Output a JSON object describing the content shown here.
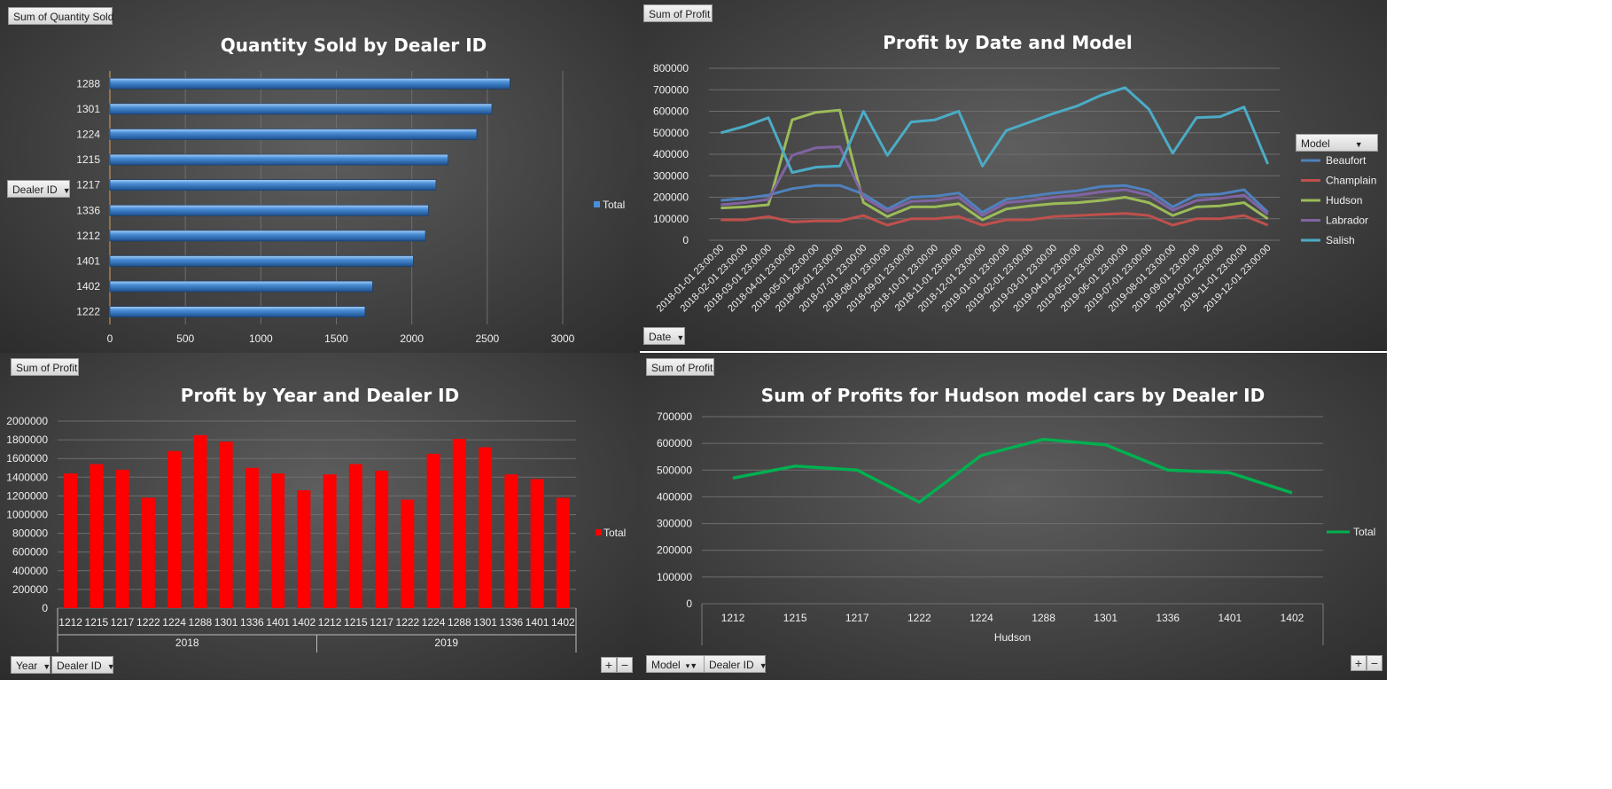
{
  "charts": {
    "c1": {
      "field_button": "Sum of Quantity Sold",
      "axis_button": "Dealer ID",
      "legend": "Total"
    },
    "c2": {
      "field_button": "Sum of Profit",
      "axis_button": "Date",
      "legend_button": "Model"
    },
    "c3": {
      "field_button": "Sum of Profit",
      "axis_buttons": [
        "Year",
        "Dealer ID"
      ],
      "legend": "Total"
    },
    "c4": {
      "field_button": "Sum of Profit",
      "axis_buttons": [
        "Model",
        "Dealer ID"
      ],
      "legend": "Total"
    }
  },
  "colors": {
    "bar_blue": "#4a8fd8",
    "line_beaufort": "#4f81bd",
    "line_champlain": "#c0504d",
    "line_hudson": "#9bbb59",
    "line_labrador": "#8064a2",
    "line_salish": "#4bacc6",
    "bar_red": "#ff0000",
    "line_green": "#00b050"
  },
  "chart_data": [
    {
      "id": "c1",
      "type": "bar",
      "orientation": "horizontal",
      "title": "Quantity Sold by Dealer ID",
      "categories": [
        "1288",
        "1301",
        "1224",
        "1215",
        "1217",
        "1336",
        "1212",
        "1401",
        "1402",
        "1222"
      ],
      "series": [
        {
          "name": "Total",
          "values": [
            2650,
            2530,
            2430,
            2240,
            2160,
            2110,
            2090,
            2010,
            1740,
            1690
          ]
        }
      ],
      "xlim": [
        0,
        3000
      ],
      "xticks": [
        0,
        500,
        1000,
        1500,
        2000,
        2500,
        3000
      ],
      "grid": true,
      "legend": "right"
    },
    {
      "id": "c2",
      "type": "line",
      "title": "Profit by Date and Model",
      "categories": [
        "2018-01-01 23:00:00",
        "2018-02-01 23:00:00",
        "2018-03-01 23:00:00",
        "2018-04-01 23:00:00",
        "2018-05-01 23:00:00",
        "2018-06-01 23:00:00",
        "2018-07-01 23:00:00",
        "2018-08-01 23:00:00",
        "2018-09-01 23:00:00",
        "2018-10-01 23:00:00",
        "2018-11-01 23:00:00",
        "2018-12-01 23:00:00",
        "2019-01-01 23:00:00",
        "2019-02-01 23:00:00",
        "2019-03-01 23:00:00",
        "2019-04-01 23:00:00",
        "2019-05-01 23:00:00",
        "2019-06-01 23:00:00",
        "2019-07-01 23:00:00",
        "2019-08-01 23:00:00",
        "2019-09-01 23:00:00",
        "2019-10-01 23:00:00",
        "2019-11-01 23:00:00",
        "2019-12-01 23:00:00"
      ],
      "series": [
        {
          "name": "Beaufort",
          "values": [
            185000,
            195000,
            210000,
            240000,
            255000,
            255000,
            215000,
            145000,
            200000,
            205000,
            220000,
            130000,
            190000,
            205000,
            220000,
            230000,
            250000,
            255000,
            230000,
            155000,
            210000,
            215000,
            235000,
            130000
          ]
        },
        {
          "name": "Champlain",
          "values": [
            95000,
            95000,
            110000,
            85000,
            90000,
            90000,
            115000,
            70000,
            100000,
            100000,
            110000,
            70000,
            95000,
            95000,
            110000,
            115000,
            120000,
            125000,
            115000,
            70000,
            100000,
            100000,
            115000,
            70000
          ]
        },
        {
          "name": "Hudson",
          "values": [
            150000,
            155000,
            165000,
            560000,
            595000,
            605000,
            175000,
            110000,
            155000,
            155000,
            170000,
            95000,
            145000,
            160000,
            170000,
            175000,
            185000,
            200000,
            175000,
            115000,
            155000,
            160000,
            175000,
            100000
          ]
        },
        {
          "name": "Labrador",
          "values": [
            165000,
            175000,
            190000,
            395000,
            430000,
            435000,
            200000,
            135000,
            180000,
            185000,
            200000,
            115000,
            175000,
            185000,
            200000,
            210000,
            225000,
            235000,
            210000,
            140000,
            185000,
            195000,
            210000,
            120000
          ]
        },
        {
          "name": "Salish",
          "values": [
            500000,
            530000,
            570000,
            315000,
            340000,
            345000,
            600000,
            395000,
            550000,
            560000,
            600000,
            345000,
            510000,
            550000,
            590000,
            625000,
            675000,
            710000,
            610000,
            405000,
            570000,
            575000,
            620000,
            355000
          ]
        }
      ],
      "ylim": [
        0,
        800000
      ],
      "yticks": [
        0,
        100000,
        200000,
        300000,
        400000,
        500000,
        600000,
        700000,
        800000
      ],
      "grid": true,
      "legend": "right"
    },
    {
      "id": "c3",
      "type": "bar",
      "title": "Profit by Year and Dealer ID",
      "groups": [
        {
          "label": "2018",
          "categories": [
            "1212",
            "1215",
            "1217",
            "1222",
            "1224",
            "1288",
            "1301",
            "1336",
            "1401",
            "1402"
          ]
        },
        {
          "label": "2019",
          "categories": [
            "1212",
            "1215",
            "1217",
            "1222",
            "1224",
            "1288",
            "1301",
            "1336",
            "1401",
            "1402"
          ]
        }
      ],
      "series": [
        {
          "name": "Total",
          "values": [
            1440000,
            1540000,
            1480000,
            1180000,
            1680000,
            1850000,
            1780000,
            1500000,
            1440000,
            1260000,
            1430000,
            1540000,
            1470000,
            1160000,
            1650000,
            1810000,
            1720000,
            1430000,
            1380000,
            1180000
          ]
        }
      ],
      "ylim": [
        0,
        2000000
      ],
      "yticks": [
        0,
        200000,
        400000,
        600000,
        800000,
        1000000,
        1200000,
        1400000,
        1600000,
        1800000,
        2000000
      ],
      "grid": true,
      "legend": "right"
    },
    {
      "id": "c4",
      "type": "line",
      "title": "Sum of Profits for Hudson model cars by Dealer ID",
      "categories": [
        "1212",
        "1215",
        "1217",
        "1222",
        "1224",
        "1288",
        "1301",
        "1336",
        "1401",
        "1402"
      ],
      "group_label": "Hudson",
      "series": [
        {
          "name": "Total",
          "values": [
            470000,
            515000,
            500000,
            380000,
            555000,
            615000,
            595000,
            500000,
            490000,
            415000
          ]
        }
      ],
      "ylim": [
        0,
        700000
      ],
      "yticks": [
        0,
        100000,
        200000,
        300000,
        400000,
        500000,
        600000,
        700000
      ],
      "grid": true,
      "legend": "right"
    }
  ]
}
